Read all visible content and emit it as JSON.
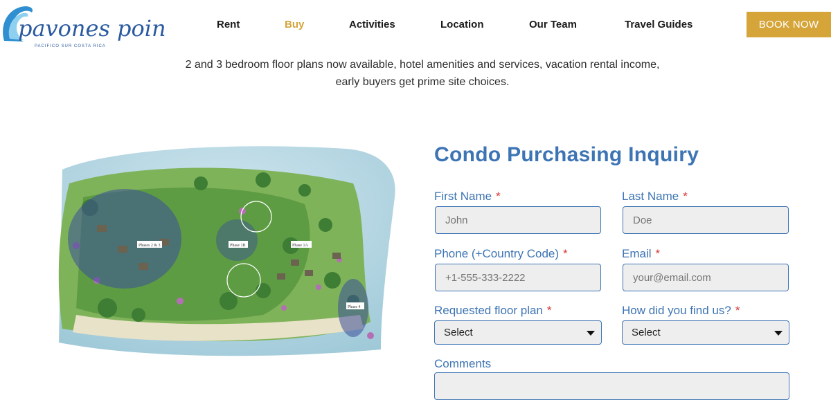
{
  "header": {
    "logo": {
      "name": "pavones point",
      "tagline": "PACIFICO SUR COSTA RICA"
    },
    "nav": [
      {
        "label": "Rent"
      },
      {
        "label": "Buy",
        "active": true
      },
      {
        "label": "Activities"
      },
      {
        "label": "Location"
      },
      {
        "label": "Our Team"
      },
      {
        "label": "Travel Guides"
      }
    ],
    "book_label": "BOOK NOW"
  },
  "intro": {
    "line1": "2 and 3 bedroom floor plans now available, hotel amenities and services, vacation rental income,",
    "line2": "early buyers get prime site choices."
  },
  "site_map": {
    "labels": [
      "Phases 2 & 3",
      "Phase 1B",
      "Phase 1A",
      "Phase 4"
    ]
  },
  "form": {
    "title": "Condo Purchasing Inquiry",
    "required_mark": "*",
    "first_name": {
      "label": "First Name",
      "placeholder": "John"
    },
    "last_name": {
      "label": "Last Name",
      "placeholder": "Doe"
    },
    "phone": {
      "label": "Phone (+Country Code)",
      "placeholder": "+1-555-333-2222"
    },
    "email": {
      "label": "Email",
      "placeholder": "your@email.com"
    },
    "floor_plan": {
      "label": "Requested floor plan",
      "value": "Select"
    },
    "source": {
      "label": "How did you find us?",
      "value": "Select"
    },
    "comments": {
      "label": "Comments"
    }
  },
  "colors": {
    "accent_blue": "#3d74b4",
    "gold": "#d6a53a",
    "required_red": "#d63a3a"
  }
}
